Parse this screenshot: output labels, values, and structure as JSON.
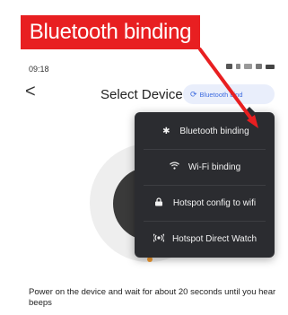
{
  "annotation": {
    "callout_label": "Bluetooth binding",
    "color": "#e81f21"
  },
  "status_bar": {
    "time": "09:18"
  },
  "header": {
    "back_icon": "chevron-left-icon",
    "back_glyph": "<",
    "title": "Select Device",
    "bind_pill": {
      "icon": "refresh-icon",
      "label": "Bluetooth bind",
      "accent": "#3f6de0"
    }
  },
  "dropdown_menu": {
    "background": "#2b2c30",
    "items": [
      {
        "icon": "bluetooth-icon",
        "label": "Bluetooth binding"
      },
      {
        "icon": "wifi-icon",
        "label": "Wi-Fi binding"
      },
      {
        "icon": "hotspot-config-icon",
        "label": "Hotspot config to wifi"
      },
      {
        "icon": "hotspot-direct-icon",
        "label": "Hotspot Direct Watch"
      }
    ]
  },
  "instruction": {
    "text": "Power on the device and wait for about 20 seconds until you hear beeps"
  },
  "colors": {
    "indicator_dot": "#f29a2e",
    "device": "#3a3a3a"
  }
}
